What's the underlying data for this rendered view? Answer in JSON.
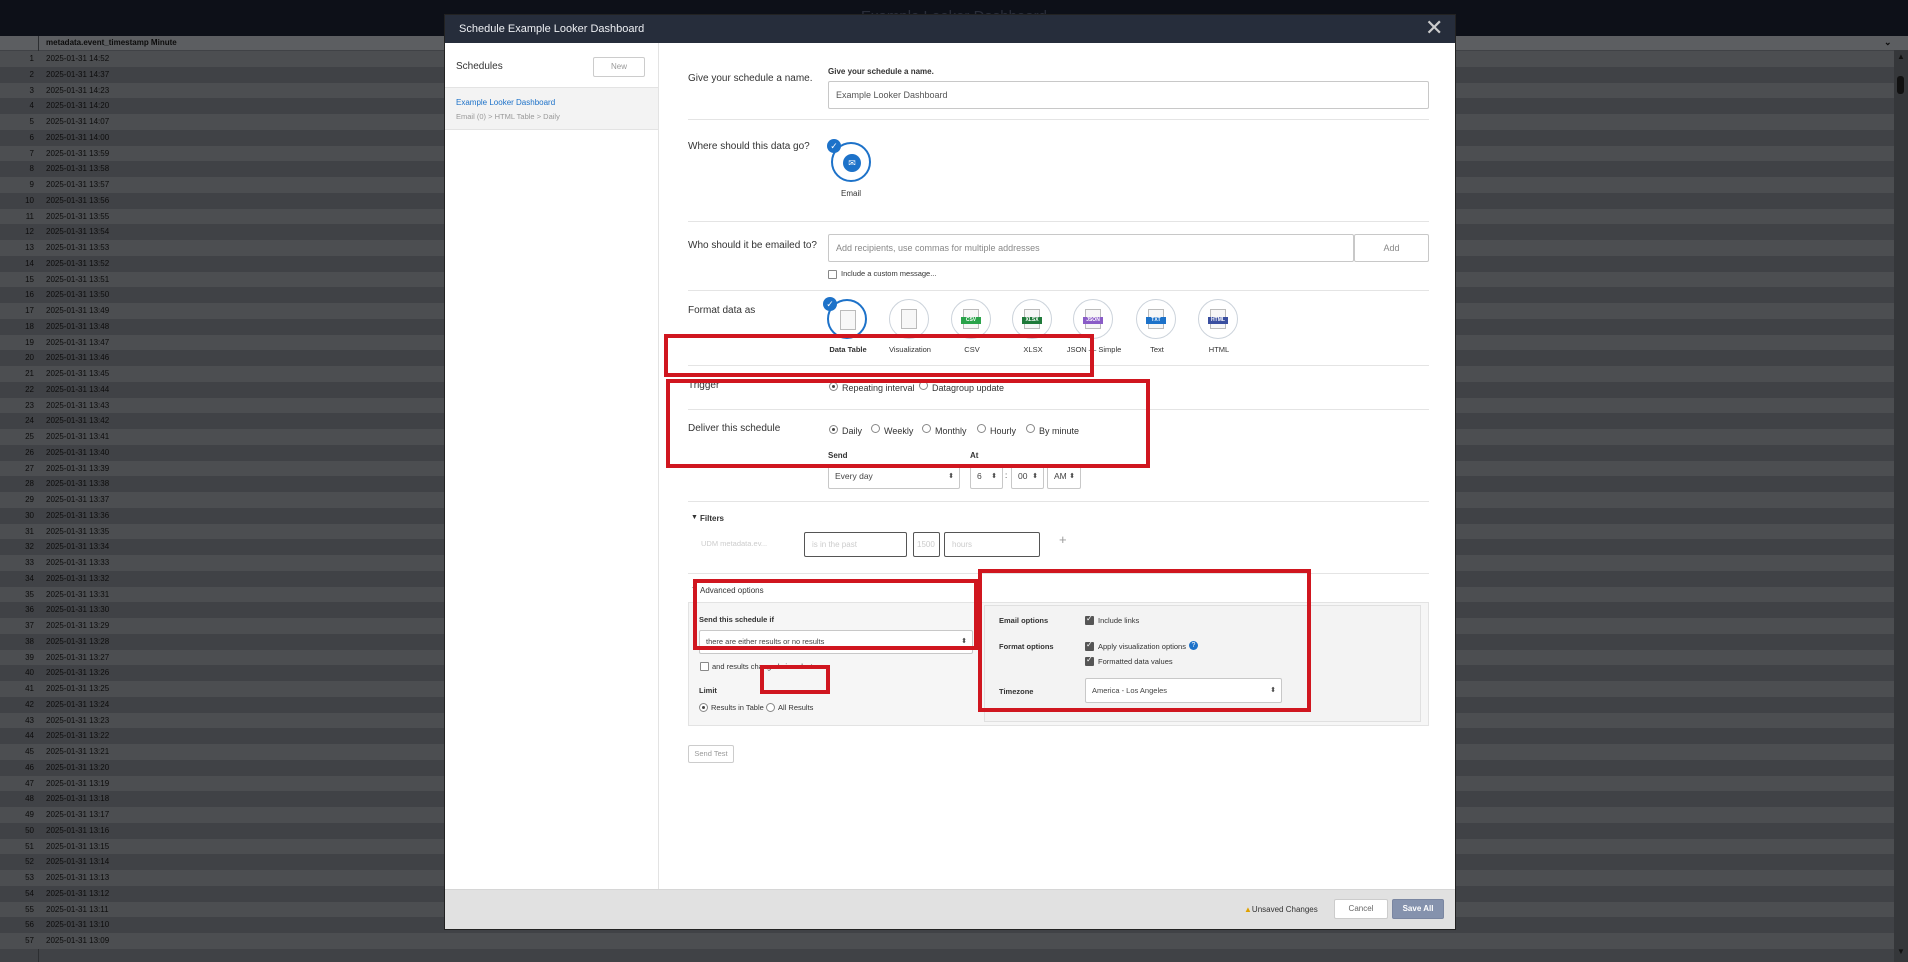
{
  "window_title": "Example Looker Dashboard",
  "table": {
    "header": "metadata.event_timestamp Minute",
    "rows": [
      {
        "n": "1",
        "d": "2025-01-31 14:52"
      },
      {
        "n": "2",
        "d": "2025-01-31 14:37"
      },
      {
        "n": "3",
        "d": "2025-01-31 14:23"
      },
      {
        "n": "4",
        "d": "2025-01-31 14:20"
      },
      {
        "n": "5",
        "d": "2025-01-31 14:07"
      },
      {
        "n": "6",
        "d": "2025-01-31 14:00"
      },
      {
        "n": "7",
        "d": "2025-01-31 13:59"
      },
      {
        "n": "8",
        "d": "2025-01-31 13:58"
      },
      {
        "n": "9",
        "d": "2025-01-31 13:57"
      },
      {
        "n": "10",
        "d": "2025-01-31 13:56"
      },
      {
        "n": "11",
        "d": "2025-01-31 13:55"
      },
      {
        "n": "12",
        "d": "2025-01-31 13:54"
      },
      {
        "n": "13",
        "d": "2025-01-31 13:53"
      },
      {
        "n": "14",
        "d": "2025-01-31 13:52"
      },
      {
        "n": "15",
        "d": "2025-01-31 13:51"
      },
      {
        "n": "16",
        "d": "2025-01-31 13:50"
      },
      {
        "n": "17",
        "d": "2025-01-31 13:49"
      },
      {
        "n": "18",
        "d": "2025-01-31 13:48"
      },
      {
        "n": "19",
        "d": "2025-01-31 13:47"
      },
      {
        "n": "20",
        "d": "2025-01-31 13:46"
      },
      {
        "n": "21",
        "d": "2025-01-31 13:45"
      },
      {
        "n": "22",
        "d": "2025-01-31 13:44"
      },
      {
        "n": "23",
        "d": "2025-01-31 13:43"
      },
      {
        "n": "24",
        "d": "2025-01-31 13:42"
      },
      {
        "n": "25",
        "d": "2025-01-31 13:41"
      },
      {
        "n": "26",
        "d": "2025-01-31 13:40"
      },
      {
        "n": "27",
        "d": "2025-01-31 13:39"
      },
      {
        "n": "28",
        "d": "2025-01-31 13:38"
      },
      {
        "n": "29",
        "d": "2025-01-31 13:37"
      },
      {
        "n": "30",
        "d": "2025-01-31 13:36"
      },
      {
        "n": "31",
        "d": "2025-01-31 13:35"
      },
      {
        "n": "32",
        "d": "2025-01-31 13:34"
      },
      {
        "n": "33",
        "d": "2025-01-31 13:33"
      },
      {
        "n": "34",
        "d": "2025-01-31 13:32"
      },
      {
        "n": "35",
        "d": "2025-01-31 13:31"
      },
      {
        "n": "36",
        "d": "2025-01-31 13:30"
      },
      {
        "n": "37",
        "d": "2025-01-31 13:29"
      },
      {
        "n": "38",
        "d": "2025-01-31 13:28"
      },
      {
        "n": "39",
        "d": "2025-01-31 13:27"
      },
      {
        "n": "40",
        "d": "2025-01-31 13:26"
      },
      {
        "n": "41",
        "d": "2025-01-31 13:25"
      },
      {
        "n": "42",
        "d": "2025-01-31 13:24"
      },
      {
        "n": "43",
        "d": "2025-01-31 13:23"
      },
      {
        "n": "44",
        "d": "2025-01-31 13:22"
      },
      {
        "n": "45",
        "d": "2025-01-31 13:21"
      },
      {
        "n": "46",
        "d": "2025-01-31 13:20"
      },
      {
        "n": "47",
        "d": "2025-01-31 13:19"
      },
      {
        "n": "48",
        "d": "2025-01-31 13:18"
      },
      {
        "n": "49",
        "d": "2025-01-31 13:17"
      },
      {
        "n": "50",
        "d": "2025-01-31 13:16"
      },
      {
        "n": "51",
        "d": "2025-01-31 13:15"
      },
      {
        "n": "52",
        "d": "2025-01-31 13:14"
      },
      {
        "n": "53",
        "d": "2025-01-31 13:13"
      },
      {
        "n": "54",
        "d": "2025-01-31 13:12"
      },
      {
        "n": "55",
        "d": "2025-01-31 13:11"
      },
      {
        "n": "56",
        "d": "2025-01-31 13:10"
      },
      {
        "n": "57",
        "d": "2025-01-31 13:09"
      }
    ]
  },
  "modal": {
    "title": "Schedule Example Looker Dashboard",
    "close_icon": "close-icon"
  },
  "sidebar": {
    "heading": "Schedules",
    "new_label": "New",
    "item_title": "Example Looker Dashboard",
    "item_sub": [
      "Email (0)",
      "HTML Table",
      "Daily"
    ]
  },
  "form": {
    "name_label": "Give your schedule a name.",
    "name_field_label": "Give your schedule a name.",
    "name_value": "Example Looker Dashboard",
    "dest_label": "Where should this data go?",
    "dest_email": "Email",
    "recipients_label": "Who should it be emailed to?",
    "recipients_placeholder": "Add recipients, use commas for multiple addresses",
    "add_label": "Add",
    "custom_message": "Include a custom message...",
    "format_label": "Format data as",
    "formats": [
      {
        "label": "Data Table",
        "badge": "",
        "color": "#1d72c9",
        "selected": true
      },
      {
        "label": "Visualization",
        "badge": "",
        "color": "#6b7b8a",
        "selected": false
      },
      {
        "label": "CSV",
        "badge": "CSV",
        "color": "#2aa34a",
        "selected": false
      },
      {
        "label": "XLSX",
        "badge": "XLSX",
        "color": "#1f7a3a",
        "selected": false
      },
      {
        "label": "JSON — Simple",
        "badge": "JSON",
        "color": "#8a5cc7",
        "selected": false
      },
      {
        "label": "Text",
        "badge": "TXT",
        "color": "#1d72c9",
        "selected": false
      },
      {
        "label": "HTML",
        "badge": "HTML",
        "color": "#3a4fa0",
        "selected": false
      }
    ],
    "trigger_label": "Trigger",
    "trigger_repeating": "Repeating interval",
    "trigger_datagroup": "Datagroup update",
    "deliver_label": "Deliver this schedule",
    "deliver_opts": [
      "Daily",
      "Weekly",
      "Monthly",
      "Hourly",
      "By minute"
    ],
    "send_label": "Send",
    "send_value": "Every day",
    "at_label": "At",
    "hour": "6",
    "time_sep": ":",
    "minute": "00",
    "ampm": "AM",
    "filters_label": "Filters",
    "filter_field": "UDM metadata.ev...",
    "filter_op": "is in the past",
    "filter_num": "1500",
    "filter_unit": "hours",
    "adv_label": "Advanced options",
    "send_if_label": "Send this schedule if",
    "send_if_value": "there are either results or no results",
    "changed_label": "and results changed since last run",
    "limit_label": "Limit",
    "limit_table": "Results in Table",
    "limit_all": "All Results",
    "email_options_label": "Email options",
    "include_links": "Include links",
    "format_options_label": "Format options",
    "apply_viz": "Apply visualization options",
    "formatted_values": "Formatted data values",
    "timezone_label": "Timezone",
    "timezone_value": "America - Los Angeles",
    "send_test": "Send Test"
  },
  "footer": {
    "unsaved": "Unsaved Changes",
    "cancel": "Cancel",
    "save_all": "Save All"
  }
}
